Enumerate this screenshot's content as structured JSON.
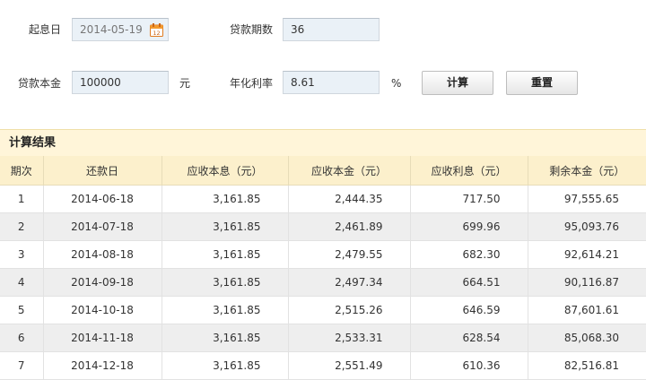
{
  "form": {
    "start_date_label": "起息日",
    "start_date_value": "2014-05-19",
    "period_label": "贷款期数",
    "period_value": "36",
    "principal_label": "贷款本金",
    "principal_value": "100000",
    "principal_unit": "元",
    "rate_label": "年化利率",
    "rate_value": "8.61",
    "rate_unit": "%",
    "calc_button": "计算",
    "reset_button": "重置",
    "calendar_icon": "calendar-icon"
  },
  "results": {
    "title": "计算结果",
    "headers": [
      "期次",
      "还款日",
      "应收本息（元）",
      "应收本金（元）",
      "应收利息（元）",
      "剩余本金（元）"
    ],
    "rows": [
      [
        "1",
        "2014-06-18",
        "3,161.85",
        "2,444.35",
        "717.50",
        "97,555.65"
      ],
      [
        "2",
        "2014-07-18",
        "3,161.85",
        "2,461.89",
        "699.96",
        "95,093.76"
      ],
      [
        "3",
        "2014-08-18",
        "3,161.85",
        "2,479.55",
        "682.30",
        "92,614.21"
      ],
      [
        "4",
        "2014-09-18",
        "3,161.85",
        "2,497.34",
        "664.51",
        "90,116.87"
      ],
      [
        "5",
        "2014-10-18",
        "3,161.85",
        "2,515.26",
        "646.59",
        "87,601.61"
      ],
      [
        "6",
        "2014-11-18",
        "3,161.85",
        "2,533.31",
        "628.54",
        "85,068.30"
      ],
      [
        "7",
        "2014-12-18",
        "3,161.85",
        "2,551.49",
        "610.36",
        "82,516.81"
      ]
    ]
  }
}
